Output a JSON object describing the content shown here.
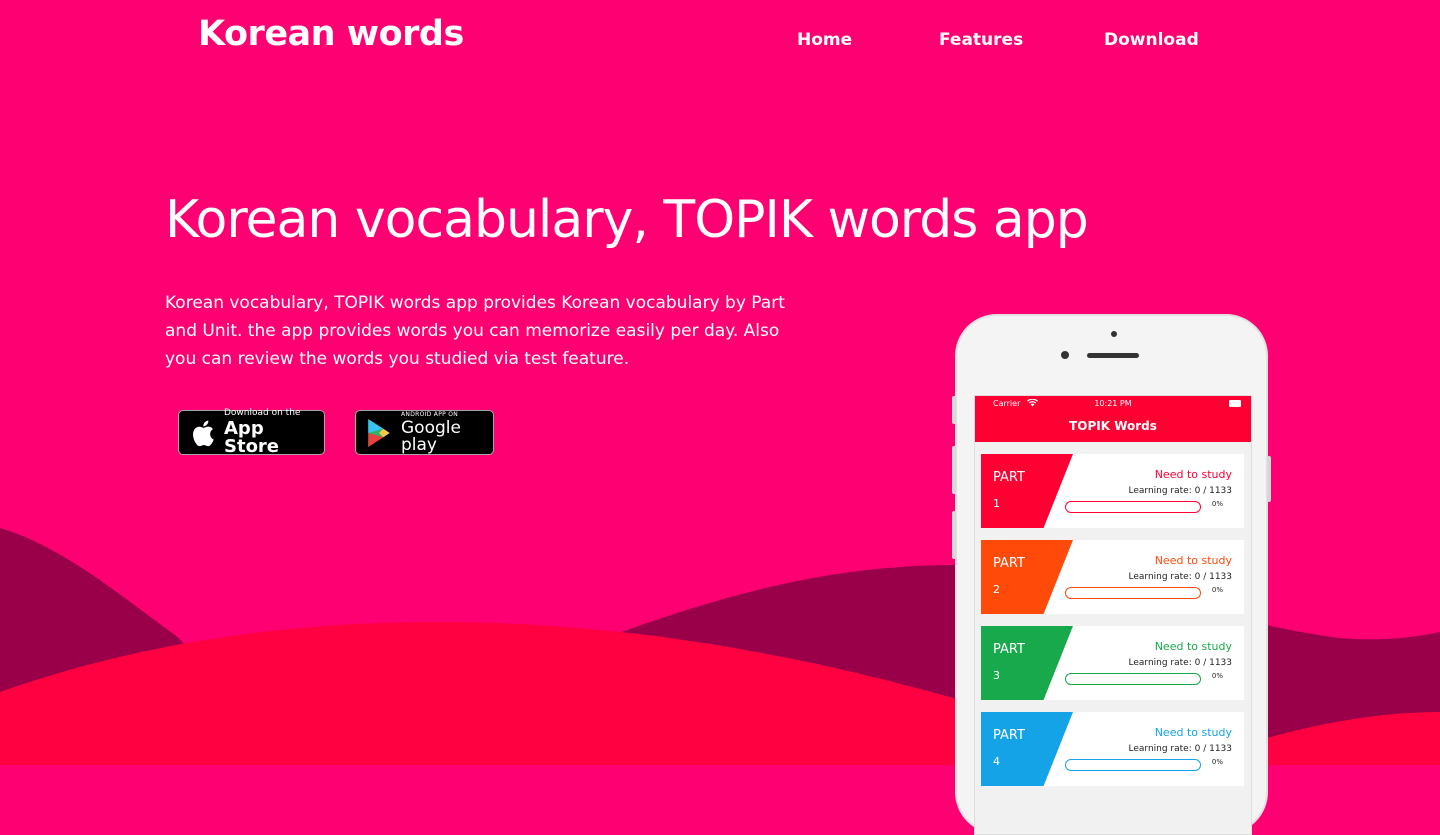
{
  "header": {
    "logo": "Korean words",
    "nav": [
      "Home",
      "Features",
      "Download"
    ]
  },
  "hero": {
    "title": "Korean vocabulary, TOPIK words app",
    "description": "Korean vocabulary, TOPIK words app provides Korean vocabulary by Part and Unit. the app provides words you can memorize easily per day. Also you can review the words you studied via test feature."
  },
  "badges": {
    "app_store": {
      "small": "Download on the",
      "big": "App Store",
      "icon": "apple-icon"
    },
    "google_play": {
      "small": "ANDROID APP ON",
      "big": "Google play",
      "icon": "play-triangle-icon"
    }
  },
  "phone": {
    "status": {
      "carrier": "Carrier",
      "time": "10:21 PM"
    },
    "app_title": "TOPIK Words",
    "parts": [
      {
        "label": "PART",
        "number": "1",
        "status": "Need to study",
        "rate": "Learning rate: 0 / 1133",
        "percent": "0%",
        "progress": 0,
        "color": "#ff0033"
      },
      {
        "label": "PART",
        "number": "2",
        "status": "Need to study",
        "rate": "Learning rate: 0 / 1133",
        "percent": "0%",
        "progress": 0,
        "color": "#ff4a0a"
      },
      {
        "label": "PART",
        "number": "3",
        "status": "Need to study",
        "rate": "Learning rate: 0 / 1133",
        "percent": "0%",
        "progress": 0,
        "color": "#18a94c"
      },
      {
        "label": "PART",
        "number": "4",
        "status": "Need to study",
        "rate": "Learning rate: 0 / 1133",
        "percent": "0%",
        "progress": 0,
        "color": "#14a3e6"
      }
    ]
  },
  "colors": {
    "background": "#ff0073",
    "wave_dark": "#9a004a",
    "wave_red": "#ff0040"
  }
}
